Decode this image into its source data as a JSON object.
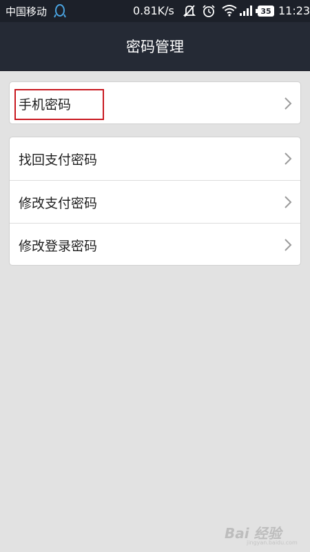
{
  "status_bar": {
    "carrier": "中国移动",
    "speed": "0.81K/s",
    "battery": "35",
    "time": "11:23",
    "icons": [
      "qq-icon",
      "notification-muted-icon",
      "alarm-icon",
      "wifi-icon",
      "signal-icon",
      "battery-icon"
    ]
  },
  "header": {
    "title": "密码管理"
  },
  "groups": [
    {
      "items": [
        {
          "label": "手机密码",
          "icon": "chevron-right-icon",
          "highlighted": true
        }
      ]
    },
    {
      "items": [
        {
          "label": "找回支付密码",
          "icon": "chevron-right-icon"
        },
        {
          "label": "修改支付密码",
          "icon": "chevron-right-icon"
        },
        {
          "label": "修改登录密码",
          "icon": "chevron-right-icon"
        }
      ]
    }
  ],
  "watermark": {
    "text": "Bai 经验",
    "sub": "jingyan.baidu.com"
  },
  "colors": {
    "status_bar": "#1c2029",
    "title_bar": "#252a35",
    "background": "#e2e2e2",
    "highlight": "#c8161e"
  }
}
